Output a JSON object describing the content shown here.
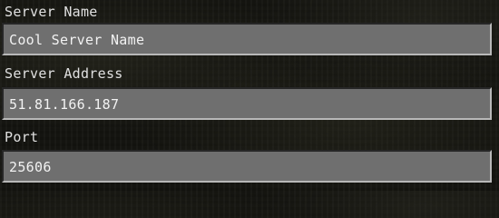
{
  "server_name": {
    "label": "Server Name",
    "value": "Cool Server Name"
  },
  "server_address": {
    "label": "Server Address",
    "value": "51.81.166.187"
  },
  "port": {
    "label": "Port",
    "value": "25606"
  }
}
